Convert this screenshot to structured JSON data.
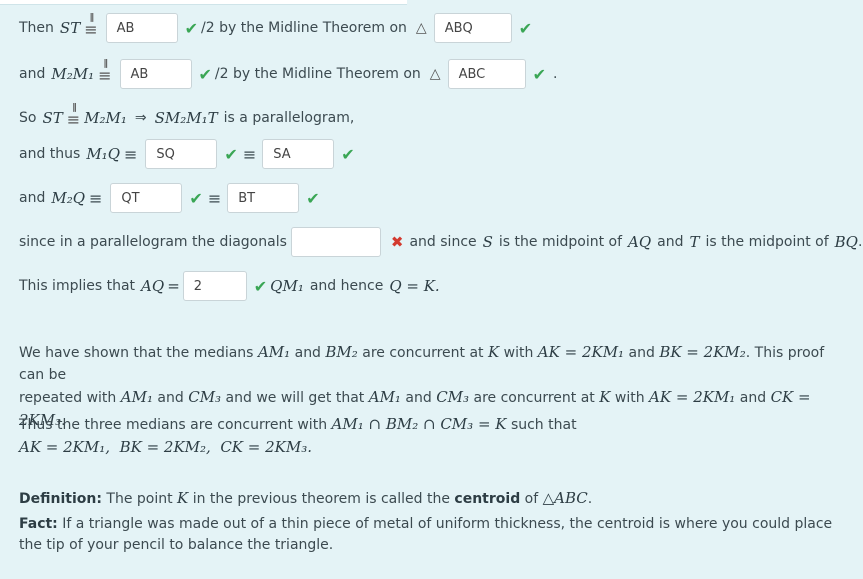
{
  "proof": {
    "l1": {
      "prefix": "Then",
      "seg": "ST",
      "answer1": "AB",
      "text": "/2 by the Midline Theorem on",
      "answer2": "ABQ"
    },
    "l2": {
      "prefix": "and",
      "seg": "M₂M₁",
      "answer1": "AB",
      "text": "/2 by the Midline Theorem on",
      "answer2": "ABC"
    },
    "l3": {
      "prefix": "So",
      "seg1": "ST",
      "seg2": "M₂M₁",
      "shape": "SM₂M₁T",
      "suffix": "is a parallelogram,"
    },
    "l4": {
      "prefix": "and thus",
      "seg": "M₁Q",
      "answer1": "SQ",
      "answer2": "SA"
    },
    "l5": {
      "prefix": "and",
      "seg": "M₂Q",
      "answer1": "QT",
      "answer2": "BT"
    },
    "l6": {
      "prefix": "since in a parallelogram the diagonals",
      "answer": "",
      "mid1": "and since",
      "s": "S",
      "mid2": "is the midpoint of",
      "seg1": "AQ",
      "mid3": "and",
      "t": "T",
      "mid4": "is the midpoint of",
      "seg2": "BQ",
      "end": "."
    },
    "l7": {
      "prefix": "This implies that",
      "lhs": "AQ",
      "answer": "2",
      "rhs": "QM₁",
      "mid": "and hence",
      "concl": "Q = K."
    }
  },
  "p1": {
    "t1": "We have shown that the medians",
    "m1": "AM₁",
    "t2": "and",
    "m2": "BM₂",
    "t3": "are concurrent at",
    "k1": "K",
    "t4": "with",
    "m3": "AK = 2KM₁",
    "t5": "and",
    "m4": "BK = 2KM₂",
    "t6": ". This proof can be",
    "t7": "repeated with",
    "m5": "AM₁",
    "t8": "and",
    "m6": "CM₃",
    "t9": "and we will get that",
    "m7": "AM₁",
    "t10": "and",
    "m8": "CM₃",
    "t11": "are concurrent at",
    "k2": "K",
    "t12": "with",
    "m9": "AK = 2KM₁",
    "t13": "and",
    "m10": "CK = 2KM₃",
    "t14": "."
  },
  "p2": {
    "t1": "Thus the three medians are concurrent with",
    "m1": "AM₁ ∩ BM₂ ∩ CM₃ = K",
    "t2": "such that",
    "m2": "AK = 2KM₁,  BK = 2KM₂,  CK = 2KM₃."
  },
  "def": {
    "label": "Definition:",
    "t1": "The point",
    "k": "K",
    "t2": "in the previous theorem is called the",
    "term": "centroid",
    "t3": "of",
    "tri": "△ABC",
    "end": "."
  },
  "fact": {
    "label": "Fact:",
    "text": "If a triangle was made out of a thin piece of metal of uniform thickness, the centroid is where you could place the tip of your pencil to balance the triangle."
  },
  "icons": {
    "check": "✔",
    "cross": "✖",
    "triangle": "△",
    "equiv": "≡",
    "parallel": "∥",
    "implies": "⇒"
  },
  "colors": {
    "background": "#e4f3f6",
    "check": "#3aa655",
    "cross": "#d33a2f"
  }
}
